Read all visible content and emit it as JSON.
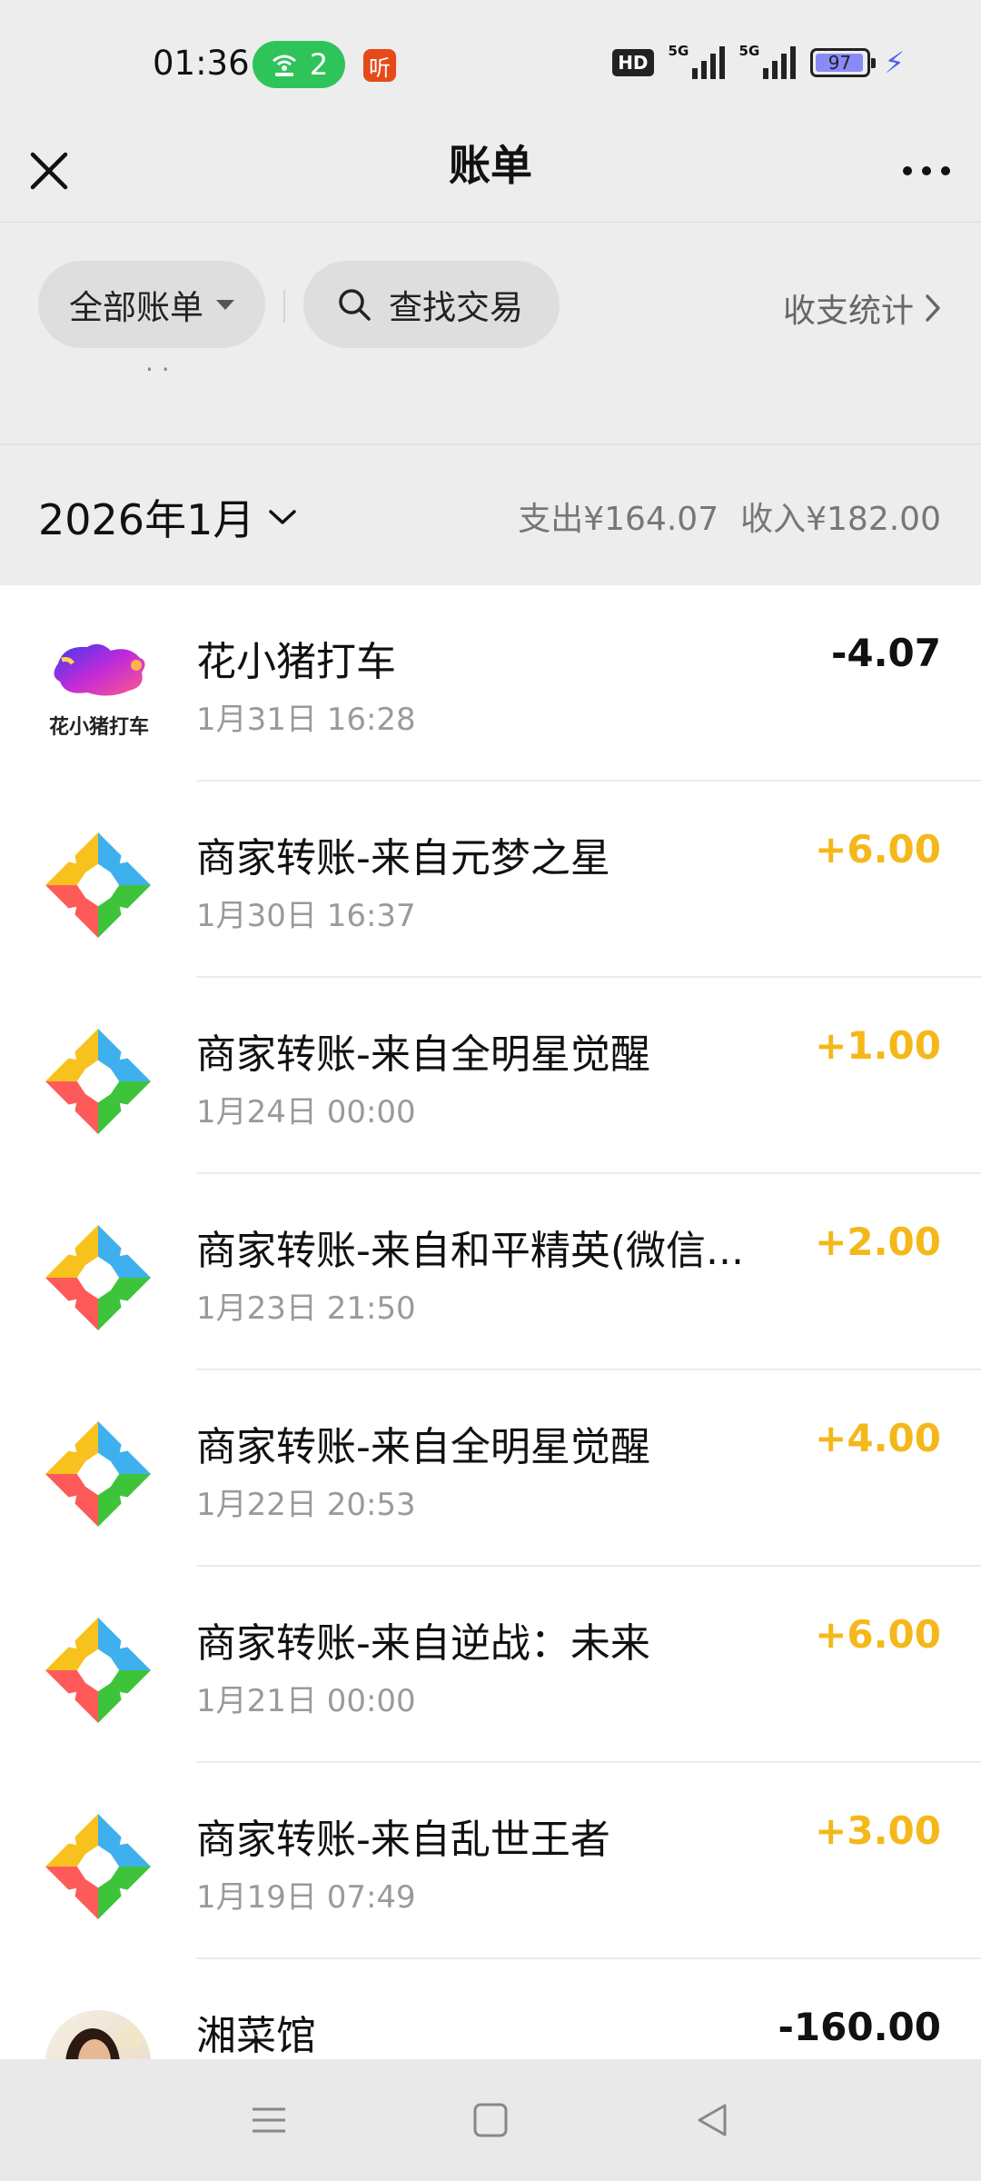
{
  "status_bar": {
    "time": "01:36",
    "hotspot_count": "2",
    "ting_label": "听",
    "hd_label": "HD",
    "signal_1_label": "5G",
    "signal_2_label": "5G",
    "battery": "97"
  },
  "header": {
    "title": "账单"
  },
  "filters": {
    "all_bills": "全部账单",
    "search": "查找交易",
    "stats": "收支统计"
  },
  "peek_text": "· ·",
  "month": {
    "label": "2026年1月",
    "expense": "支出¥164.07",
    "income": "收入¥182.00"
  },
  "transactions": [
    {
      "title": "花小猪打车",
      "time": "1月31日 16:28",
      "amount": "-4.07",
      "type": "expense",
      "icon": "huaxiaozhu-logo-icon",
      "icon_text": "花小猪打车"
    },
    {
      "title": "商家转账-来自元梦之星",
      "time": "1月30日 16:37",
      "amount": "+6.00",
      "type": "income",
      "icon": "merchant-transfer-icon"
    },
    {
      "title": "商家转账-来自全明星觉醒",
      "time": "1月24日 00:00",
      "amount": "+1.00",
      "type": "income",
      "icon": "merchant-transfer-icon"
    },
    {
      "title": "商家转账-来自和平精英(微信...",
      "time": "1月23日 21:50",
      "amount": "+2.00",
      "type": "income",
      "icon": "merchant-transfer-icon"
    },
    {
      "title": "商家转账-来自全明星觉醒",
      "time": "1月22日 20:53",
      "amount": "+4.00",
      "type": "income",
      "icon": "merchant-transfer-icon"
    },
    {
      "title": "商家转账-来自逆战：未来",
      "time": "1月21日 00:00",
      "amount": "+6.00",
      "type": "income",
      "icon": "merchant-transfer-icon"
    },
    {
      "title": "商家转账-来自乱世王者",
      "time": "1月19日 07:49",
      "amount": "+3.00",
      "type": "income",
      "icon": "merchant-transfer-icon"
    },
    {
      "title": "湘菜馆",
      "time": "",
      "amount": "-160.00",
      "type": "expense",
      "icon": "avatar-photo-icon"
    }
  ],
  "colors": {
    "background": "#ededed",
    "income": "#f4b81a",
    "expense": "#111111",
    "hotspot_pill": "#2fc45a"
  }
}
